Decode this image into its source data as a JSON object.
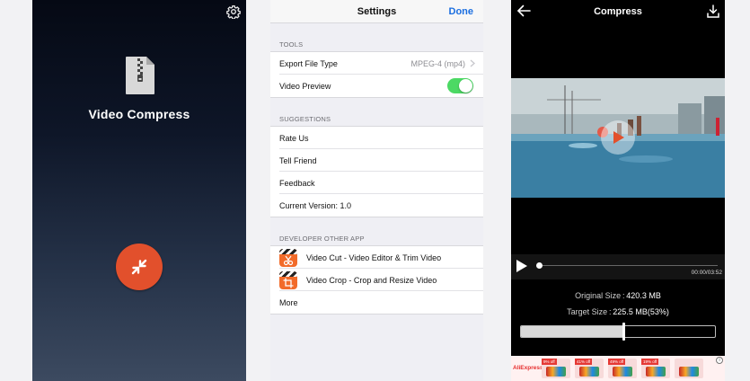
{
  "splash": {
    "title": "Video Compress",
    "icons": {
      "settings": "gear-icon",
      "logo": "zip-file-icon",
      "action": "compress-arrows-icon"
    },
    "accent_color": "#e2502c"
  },
  "settings": {
    "title": "Settings",
    "done_label": "Done",
    "accent_color": "#1a6ee0",
    "tools_header": "TOOLS",
    "export_label": "Export File Type",
    "export_value": "MPEG-4 (mp4)",
    "preview_label": "Video Preview",
    "preview_enabled": true,
    "toggle_color": "#4cd964",
    "suggestions_header": "SUGGESTIONS",
    "rate_label": "Rate Us",
    "tell_label": "Tell Friend",
    "feedback_label": "Feedback",
    "version_label": "Current Version: 1.0",
    "developer_header": "DEVELOPER OTHER APP",
    "app1_label": "Video Cut - Video Editor & Trim Video",
    "app2_label": "Video Crop - Crop and Resize Video",
    "more_label": "More"
  },
  "compress": {
    "title": "Compress",
    "icons": {
      "back": "arrow-left-icon",
      "download": "download-icon",
      "play": "play-icon"
    },
    "time": "00:00/03:52",
    "original_label": "Original Size",
    "original_value": "420.3 MB",
    "target_label": "Target Size",
    "target_value": "225.5 MB(53%)",
    "target_fraction": 0.53,
    "ad": {
      "brand": "AliExpress",
      "tags": [
        "9% off",
        "41% off",
        "49% off",
        "19% off",
        ""
      ]
    }
  }
}
